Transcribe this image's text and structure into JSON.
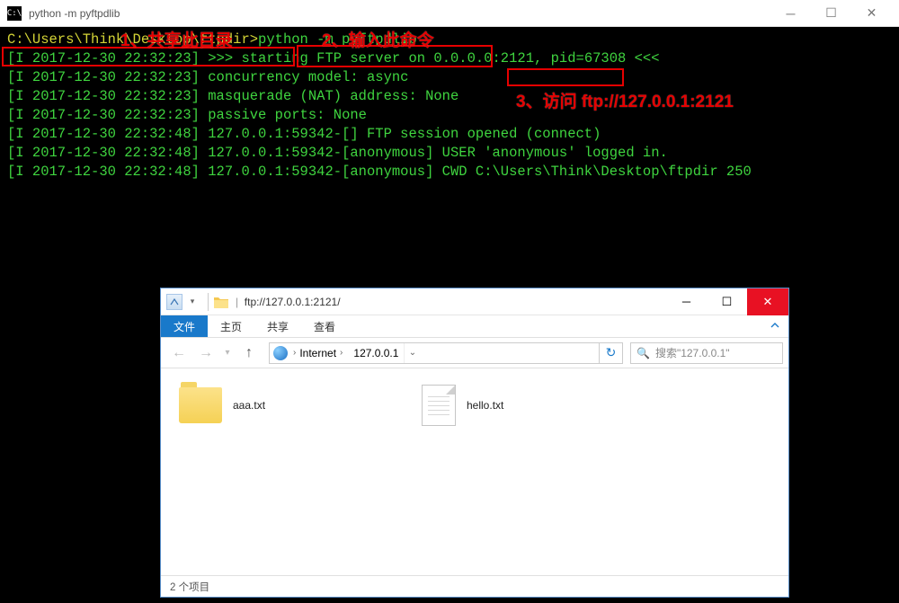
{
  "terminal": {
    "icon_text": "C:\\",
    "title": "python  -m pyftpdlib",
    "prompt_path": "C:\\Users\\Think\\Desktop\\ftpdir>",
    "command": "python -m pyftpdlib",
    "lines": [
      {
        "prefix": "[I 2017-12-30 22:32:23]",
        "text": " >>> starting FTP server on ",
        "highlight": "0.0.0.0:2121",
        "suffix": ", pid=67308 <<<"
      },
      {
        "prefix": "[I 2017-12-30 22:32:23]",
        "text": " concurrency model: async"
      },
      {
        "prefix": "[I 2017-12-30 22:32:23]",
        "text": " masquerade (NAT) address: None"
      },
      {
        "prefix": "[I 2017-12-30 22:32:23]",
        "text": " passive ports: None"
      },
      {
        "prefix": "[I 2017-12-30 22:32:48]",
        "text": " 127.0.0.1:59342-[] FTP session opened (connect)"
      },
      {
        "prefix": "[I 2017-12-30 22:32:48]",
        "text": " 127.0.0.1:59342-[anonymous] USER 'anonymous' logged in."
      },
      {
        "prefix": "[I 2017-12-30 22:32:48]",
        "text": " 127.0.0.1:59342-[anonymous] CWD C:\\Users\\Think\\Desktop\\ftpdir 250"
      }
    ]
  },
  "annotations": {
    "label1": "1、共享此目录",
    "label2": "2、输入此命令",
    "label3": "3、访问 ftp://127.0.0.1:2121"
  },
  "explorer": {
    "title": "ftp://127.0.0.1:2121/",
    "ribbon": {
      "file": "文件",
      "home": "主页",
      "share": "共享",
      "view": "查看"
    },
    "address": {
      "seg1": "Internet",
      "seg2": "127.0.0.1"
    },
    "search_placeholder": "搜索\"127.0.0.1\"",
    "files": [
      {
        "type": "folder",
        "name": "aaa.txt"
      },
      {
        "type": "doc",
        "name": "hello.txt"
      }
    ],
    "status": "2 个项目"
  }
}
